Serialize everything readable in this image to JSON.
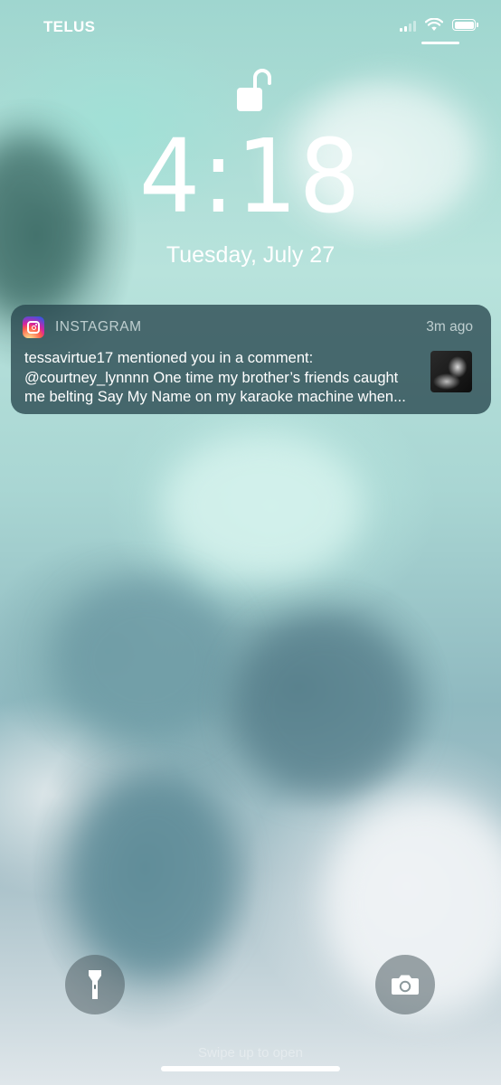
{
  "status_bar": {
    "carrier": "TELUS",
    "signal_icon": "signal-bars-icon",
    "wifi_icon": "wifi-icon",
    "battery_icon": "battery-icon",
    "battery_level": 1.0
  },
  "lock_screen": {
    "lock_icon": "unlocked-padlock-icon",
    "time": "4:18",
    "date": "Tuesday, July 27"
  },
  "notification": {
    "app_name": "INSTAGRAM",
    "app_icon": "instagram-icon",
    "time_ago": "3m ago",
    "lines": [
      "tessavirtue17 mentioned you in a comment:",
      "@courtney_lynnnn One time my brother’s friends caught",
      "me belting Say My Name on my karaoke machine when..."
    ],
    "thumbnail": "post-thumbnail"
  },
  "bottom": {
    "flashlight_icon": "flashlight-icon",
    "camera_icon": "camera-icon",
    "swipe_hint": "Swipe up to open"
  },
  "colors": {
    "notification_bg": "#2b4a52",
    "text": "#ffffff"
  }
}
